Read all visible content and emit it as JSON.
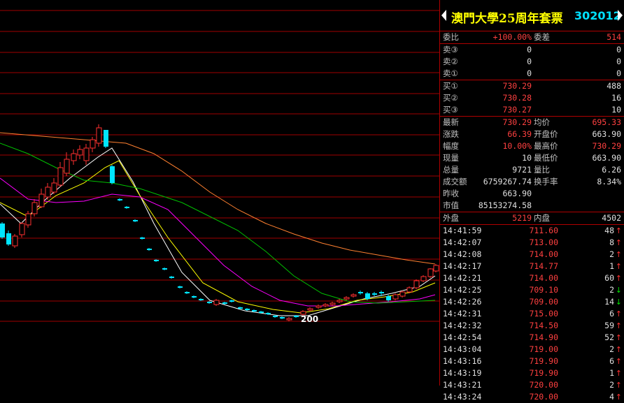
{
  "stock": {
    "name": "澳門大學25周年套票",
    "code": "302012"
  },
  "ratio": {
    "label1": "委比",
    "value1": "+100.00%",
    "label2": "委差",
    "value2": "514"
  },
  "asks": [
    {
      "label": "卖③",
      "price": "0",
      "vol": "0"
    },
    {
      "label": "卖②",
      "price": "0",
      "vol": "0"
    },
    {
      "label": "卖①",
      "price": "0",
      "vol": "0"
    }
  ],
  "bids": [
    {
      "label": "买①",
      "price": "730.29",
      "vol": "488"
    },
    {
      "label": "买②",
      "price": "730.28",
      "vol": "16"
    },
    {
      "label": "买③",
      "price": "730.27",
      "vol": "10"
    }
  ],
  "quote": [
    {
      "l1": "最新",
      "v1": "730.29",
      "c1": "red",
      "l2": "均价",
      "v2": "695.33",
      "c2": "red"
    },
    {
      "l1": "涨跌",
      "v1": "66.39",
      "c1": "red",
      "l2": "开盘价",
      "v2": "663.90",
      "c2": "wht"
    },
    {
      "l1": "幅度",
      "v1": "10.00%",
      "c1": "red",
      "l2": "最高价",
      "v2": "730.29",
      "c2": "red"
    },
    {
      "l1": "现量",
      "v1": "10",
      "c1": "wht",
      "l2": "最低价",
      "v2": "663.90",
      "c2": "wht"
    },
    {
      "l1": "总量",
      "v1": "9721",
      "c1": "wht",
      "l2": "量比",
      "v2": "6.26",
      "c2": "wht"
    },
    {
      "l1": "成交额",
      "v1": "6759267.74",
      "c1": "wht",
      "l2": "换手率",
      "v2": "8.34%",
      "c2": "wht"
    },
    {
      "l1": "昨收",
      "v1": "663.90",
      "c1": "wht",
      "l2": "",
      "v2": "",
      "c2": "wht"
    },
    {
      "l1": "市值",
      "v1": "85153274.58",
      "c1": "wht",
      "l2": "",
      "v2": "",
      "c2": "wht"
    }
  ],
  "outer_inner": {
    "label1": "外盘",
    "value1": "5219",
    "label2": "内盘",
    "value2": "4502"
  },
  "ticks": [
    {
      "time": "14:41:59",
      "price": "711.60",
      "vol": "48",
      "dir": "↑"
    },
    {
      "time": "14:42:07",
      "price": "713.00",
      "vol": "8",
      "dir": "↑"
    },
    {
      "time": "14:42:08",
      "price": "714.00",
      "vol": "2",
      "dir": "↑"
    },
    {
      "time": "14:42:17",
      "price": "714.77",
      "vol": "1",
      "dir": "↑"
    },
    {
      "time": "14:42:21",
      "price": "714.00",
      "vol": "60",
      "dir": "↑"
    },
    {
      "time": "14:42:25",
      "price": "709.10",
      "vol": "2",
      "dir": "↓"
    },
    {
      "time": "14:42:26",
      "price": "709.00",
      "vol": "14",
      "dir": "↓"
    },
    {
      "time": "14:42:31",
      "price": "715.00",
      "vol": "6",
      "dir": "↑"
    },
    {
      "time": "14:42:32",
      "price": "714.50",
      "vol": "59",
      "dir": "↑"
    },
    {
      "time": "14:42:54",
      "price": "714.90",
      "vol": "52",
      "dir": "↑"
    },
    {
      "time": "14:43:04",
      "price": "719.00",
      "vol": "2",
      "dir": "↑"
    },
    {
      "time": "14:43:16",
      "price": "719.90",
      "vol": "6",
      "dir": "↑"
    },
    {
      "time": "14:43:19",
      "price": "719.90",
      "vol": "1",
      "dir": "↑"
    },
    {
      "time": "14:43:21",
      "price": "720.00",
      "vol": "2",
      "dir": "↑"
    },
    {
      "time": "14:43:24",
      "price": "720.00",
      "vol": "4",
      "dir": "↑"
    }
  ],
  "chart": {
    "low_marker": "200",
    "colors": {
      "up": "#ff3030",
      "down": "#00e5ff",
      "grid": "#a00000",
      "ma1": "#ffffff",
      "ma2": "#ffff00",
      "ma3": "#ff00ff",
      "ma4": "#00c000",
      "ma5": "#ff8030"
    }
  }
}
